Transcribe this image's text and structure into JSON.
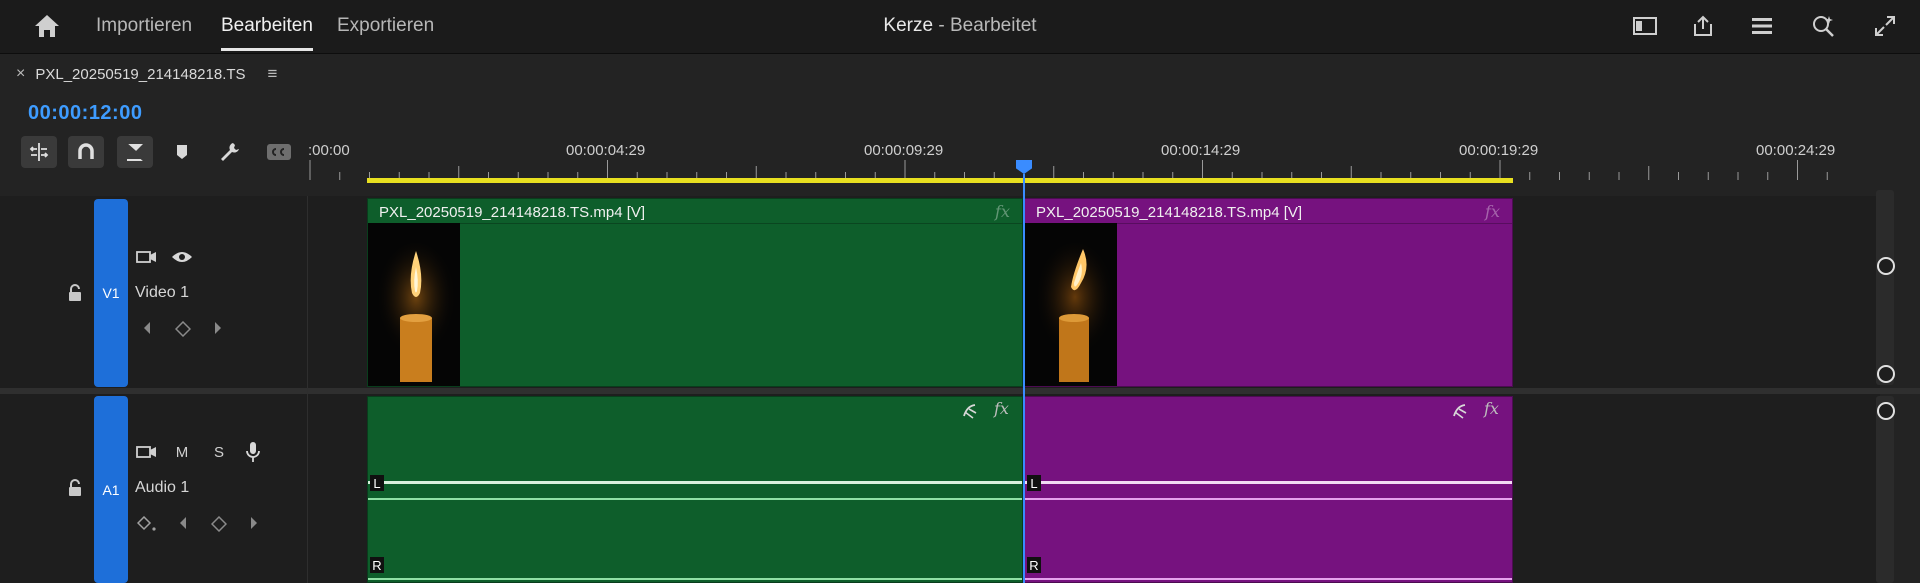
{
  "nav": {
    "tabs": [
      {
        "label": "Importieren"
      },
      {
        "label": "Bearbeiten",
        "active": true
      },
      {
        "label": "Exportieren"
      }
    ]
  },
  "project": {
    "name": "Kerze",
    "state": "- Bearbeitet"
  },
  "top_icons": [
    "workspace-panel-icon",
    "share-icon",
    "menu-list-icon",
    "search-zoom-icon",
    "fullscreen-icon"
  ],
  "sequence": {
    "tab_label": "PXL_20250519_214148218.TS",
    "close_glyph": "×",
    "menu_glyph": "≡"
  },
  "timecode": "00:00:12:00",
  "tools": [
    "insert-edit-icon",
    "snap-magnet-icon",
    "linked-selection-icon",
    "marker-icon",
    "wrench-icon",
    "captions-icon"
  ],
  "ruler": {
    "labels": [
      ":00:00",
      "00:00:04:29",
      "00:00:09:29",
      "00:00:14:29",
      "00:00:19:29",
      "00:00:24:29"
    ]
  },
  "tracks": {
    "video": {
      "id": "V1",
      "name": "Video 1"
    },
    "audio": {
      "id": "A1",
      "name": "Audio 1",
      "mute": "M",
      "solo": "S"
    }
  },
  "clips": {
    "video": [
      {
        "title": "PXL_20250519_214148218.TS.mp4 [V]",
        "color": "#0e5e2b"
      },
      {
        "title": "PXL_20250519_214148218.TS.mp4 [V]",
        "color": "#76127f"
      }
    ],
    "fx_label": "fx",
    "channel_left": "L",
    "channel_right": "R"
  },
  "colors": {
    "accent": "#3a8cff",
    "work_area": "#e8e020",
    "track_target": "#1e6fd9"
  }
}
